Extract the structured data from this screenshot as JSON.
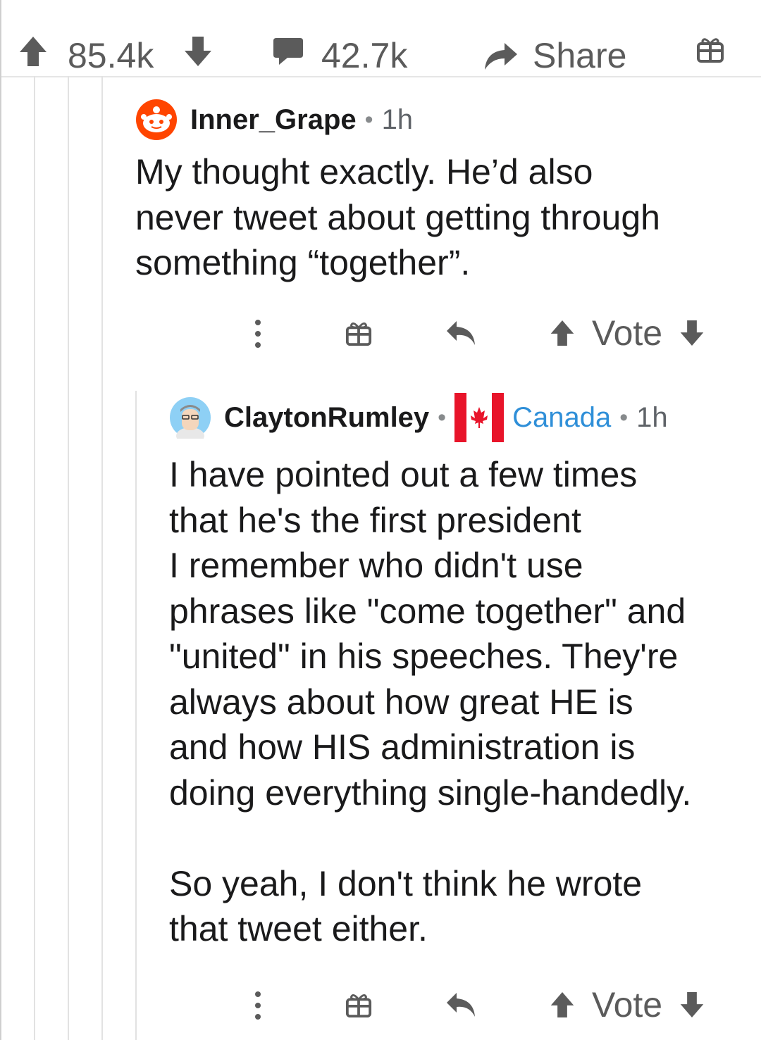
{
  "post_bar": {
    "upvotes": "85.4k",
    "comments": "42.7k",
    "share_label": "Share"
  },
  "comments": [
    {
      "username": "Inner_Grape",
      "time": "1h",
      "body": "My thought exactly. He’d also\nnever tweet about getting through\nsomething “together”.",
      "vote_label": "Vote"
    },
    {
      "username": "ClaytonRumley",
      "flair": "Canada",
      "time": "1h",
      "body": "I have pointed out a few times\nthat he's the first president\nI remember who didn't use\nphrases like \"come together\" and\n\"united\" in his speeches. They're\nalways about how great HE is\nand how HIS administration is\ndoing everything single-handedly.\n\nSo yeah, I don't think he wrote\nthat tweet either.",
      "vote_label": "Vote"
    }
  ],
  "colors": {
    "accent_blue": "#2f8fd8",
    "icon_gray": "#5b5b5b",
    "canada_red": "#e8142a"
  }
}
